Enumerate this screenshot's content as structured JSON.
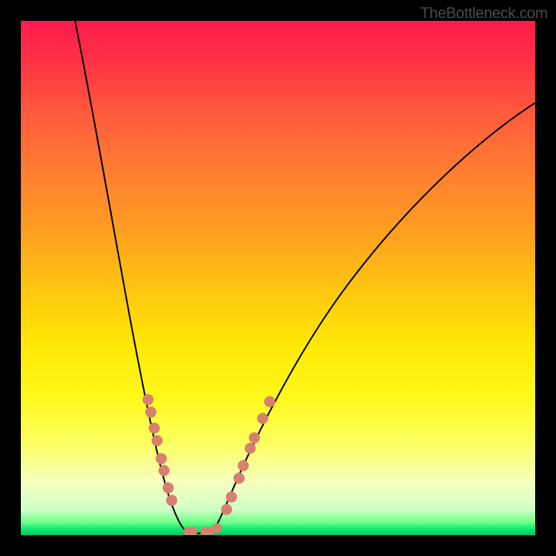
{
  "watermark": "TheBottleneck.com",
  "chart_data": {
    "type": "line",
    "title": "",
    "xlabel": "",
    "ylabel": "",
    "xlim": [
      0,
      100
    ],
    "ylim": [
      0,
      100
    ],
    "grid": false,
    "legend": false,
    "series": [
      {
        "name": "left_curve",
        "x": [
          10.5,
          14,
          17.5,
          21,
          24,
          27,
          29,
          31,
          33.4
        ],
        "y": [
          100,
          78,
          56,
          36,
          21,
          11,
          5,
          1.5,
          0.4
        ]
      },
      {
        "name": "right_curve",
        "x": [
          36.2,
          39,
          42,
          46,
          52,
          60,
          70,
          82,
          100
        ],
        "y": [
          0.4,
          2,
          6,
          14,
          28,
          46,
          64,
          78,
          84
        ]
      },
      {
        "name": "left_markers",
        "x": [
          24.7,
          25.3,
          25.9,
          26.5,
          27.3,
          27.8,
          28.6,
          29.3
        ],
        "y": [
          26.4,
          23.9,
          20.8,
          18.4,
          14.9,
          12.6,
          9.2,
          6.8
        ]
      },
      {
        "name": "right_markers",
        "x": [
          40.0,
          40.9,
          42.4,
          43.2,
          44.6,
          45.4,
          47.0,
          48.4
        ],
        "y": [
          5.0,
          7.4,
          11.1,
          13.5,
          16.9,
          18.9,
          22.7,
          26.0
        ]
      },
      {
        "name": "trough_markers",
        "x": [
          33.0,
          36.2,
          38.1
        ],
        "y": [
          0.7,
          0.7,
          1.4
        ]
      }
    ],
    "background_gradient": {
      "orientation": "vertical_top_to_bottom",
      "stops": [
        {
          "pos": 0.0,
          "color": "#ff1a4d"
        },
        {
          "pos": 0.3,
          "color": "#ff8030"
        },
        {
          "pos": 0.63,
          "color": "#ffe805"
        },
        {
          "pos": 0.9,
          "color": "#f5ffc0"
        },
        {
          "pos": 1.0,
          "color": "#00c853"
        }
      ]
    },
    "marker_color": "#d88070"
  }
}
